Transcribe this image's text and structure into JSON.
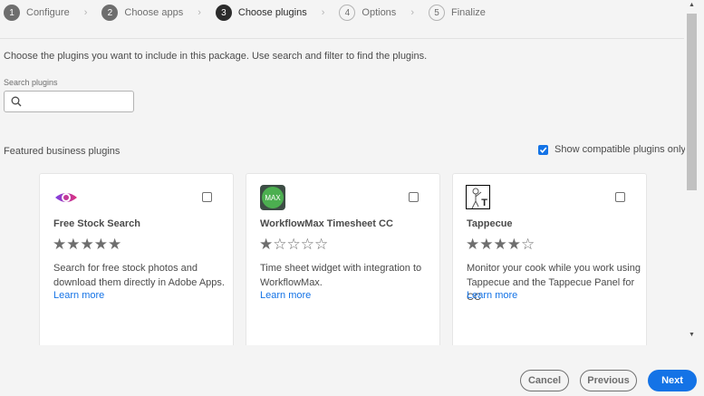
{
  "stepper": [
    {
      "num": "1",
      "label": "Configure",
      "state": "done"
    },
    {
      "num": "2",
      "label": "Choose apps",
      "state": "done"
    },
    {
      "num": "3",
      "label": "Choose plugins",
      "state": "active"
    },
    {
      "num": "4",
      "label": "Options",
      "state": "todo"
    },
    {
      "num": "5",
      "label": "Finalize",
      "state": "todo"
    }
  ],
  "intro": "Choose the plugins you want to include in this package. Use search and filter to find the plugins.",
  "search": {
    "label": "Search plugins",
    "value": "",
    "placeholder": ""
  },
  "featured_heading": "Featured business plugins",
  "compatible_only": {
    "label": "Show compatible plugins only",
    "checked": true
  },
  "plugins": [
    {
      "title": "Free Stock Search",
      "rating": 5,
      "stars": "★★★★★",
      "description": "Search for free stock photos and download them directly in Adobe Apps.",
      "learn_more": "Learn more",
      "selected": false
    },
    {
      "title": "WorkflowMax Timesheet CC",
      "rating": 1,
      "stars": "★☆☆☆☆",
      "logo_text": "MAX",
      "description": "Time sheet widget with integration to WorkflowMax.",
      "learn_more": "Learn more",
      "selected": false
    },
    {
      "title": "Tappecue",
      "rating": 4,
      "stars": "★★★★☆",
      "logo_text": "T",
      "description": "Monitor your cook while you work using Tappecue and the Tappecue Panel for CC",
      "learn_more": "Learn more",
      "selected": false
    }
  ],
  "buttons": {
    "cancel": "Cancel",
    "previous": "Previous",
    "next": "Next"
  },
  "colors": {
    "accent": "#1473e6",
    "background": "#f4f4f4"
  }
}
